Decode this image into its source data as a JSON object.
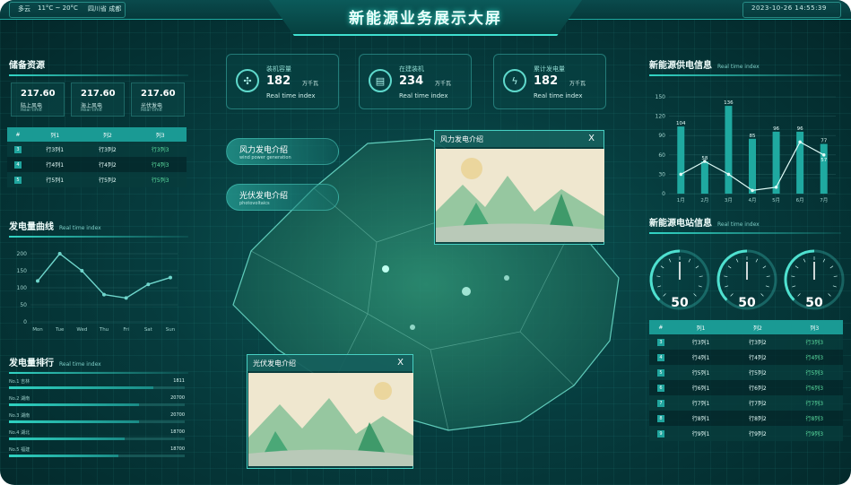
{
  "header": {
    "title": "新能源业务展示大屏",
    "weather": "多云",
    "temperature": "11°C ~ 20°C",
    "location": "四川省 成都",
    "datetime": "2023-10-26 14:55:39"
  },
  "reserve": {
    "title": "储备资源",
    "stats": [
      {
        "value": "217.60",
        "name": "陆上风电",
        "sub": "Real time"
      },
      {
        "value": "217.60",
        "name": "海上风电",
        "sub": "Real time"
      },
      {
        "value": "217.60",
        "name": "光伏发电",
        "sub": "Real time"
      }
    ],
    "table": {
      "headers": [
        "#",
        "列1",
        "列2",
        "列3"
      ],
      "rows": [
        [
          "3",
          "行3列1",
          "行3列2",
          "行3列3"
        ],
        [
          "4",
          "行4列1",
          "行4列2",
          "行4列3"
        ],
        [
          "5",
          "行5列1",
          "行5列2",
          "行5列3"
        ]
      ]
    }
  },
  "curve": {
    "title": "发电量曲线",
    "subtitle": "Real time index",
    "chart_data": {
      "type": "line",
      "categories": [
        "Mon",
        "Tue",
        "Wed",
        "Thu",
        "Fri",
        "Sat",
        "Sun"
      ],
      "values": [
        120,
        200,
        150,
        80,
        70,
        110,
        130
      ],
      "ylim": [
        0,
        200
      ],
      "yticks": [
        0,
        50,
        100,
        150,
        200
      ],
      "color": "#6fd6cc"
    }
  },
  "ranking": {
    "title": "发电量排行",
    "subtitle": "Real time index",
    "items": [
      {
        "label": "No.1 吉林",
        "value": "1811",
        "ratio": 0.82
      },
      {
        "label": "No.2 湖南",
        "value": "20700",
        "ratio": 0.74
      },
      {
        "label": "No.3 湖南",
        "value": "20700",
        "ratio": 0.74
      },
      {
        "label": "No.4 湖北",
        "value": "18700",
        "ratio": 0.66
      },
      {
        "label": "No.5 福建",
        "value": "18700",
        "ratio": 0.62
      }
    ]
  },
  "kpis": [
    {
      "label": "装机容量",
      "value": "182",
      "unit": "万千瓦",
      "sub": "Real time index",
      "icon": "fan-icon",
      "glyph": "✣"
    },
    {
      "label": "在建装机",
      "value": "234",
      "unit": "万千瓦",
      "sub": "Real time index",
      "icon": "building-icon",
      "glyph": "▤"
    },
    {
      "label": "累计发电量",
      "value": "182",
      "unit": "万千瓦",
      "sub": "Real time index",
      "icon": "plug-icon",
      "glyph": "ϟ"
    }
  ],
  "intros": [
    {
      "title": "风力发电介绍",
      "sub": "wind power generation"
    },
    {
      "title": "光伏发电介绍",
      "sub": "photovoltaics"
    }
  ],
  "popups": {
    "wind": {
      "title": "风力发电介绍",
      "close": "X"
    },
    "solar": {
      "title": "光伏发电介绍",
      "close": "X"
    }
  },
  "supply": {
    "title": "新能源供电信息",
    "subtitle": "Real time index",
    "chart_data": {
      "type": "bar",
      "categories": [
        "1月",
        "2月",
        "3月",
        "4月",
        "5月",
        "6月",
        "7月"
      ],
      "series": [
        {
          "name": "bar",
          "values": [
            104,
            50,
            136,
            85,
            96,
            96,
            77
          ]
        },
        {
          "name": "line",
          "values": [
            30,
            50,
            30,
            5,
            10,
            80,
            60
          ]
        }
      ],
      "bar_labels": [
        "104",
        "58",
        "136",
        "85",
        "96",
        "96",
        "77"
      ],
      "inner_labels": [
        "",
        "",
        "",
        "",
        "",
        "",
        "57"
      ],
      "ylim": [
        0,
        150
      ],
      "yticks": [
        0,
        30,
        60,
        90,
        120,
        150
      ],
      "bar_color": "#1fa9a0",
      "line_color": "#dffbf7"
    }
  },
  "stations": {
    "title": "新能源电站信息",
    "subtitle": "Real time index",
    "gauges": [
      {
        "value": 50,
        "max": 100,
        "label": "50"
      },
      {
        "value": 50,
        "max": 100,
        "label": "50"
      },
      {
        "value": 50,
        "max": 100,
        "label": "50"
      }
    ],
    "table": {
      "headers": [
        "#",
        "列1",
        "列2",
        "列3"
      ],
      "rows": [
        [
          "3",
          "行3列1",
          "行3列2",
          "行3列3"
        ],
        [
          "4",
          "行4列1",
          "行4列2",
          "行4列3"
        ],
        [
          "5",
          "行5列1",
          "行5列2",
          "行5列3"
        ],
        [
          "6",
          "行6列1",
          "行6列2",
          "行6列3"
        ],
        [
          "7",
          "行7列1",
          "行7列2",
          "行7列3"
        ],
        [
          "8",
          "行8列1",
          "行8列2",
          "行8列3"
        ],
        [
          "9",
          "行9列1",
          "行9列2",
          "行9列3"
        ]
      ]
    }
  }
}
